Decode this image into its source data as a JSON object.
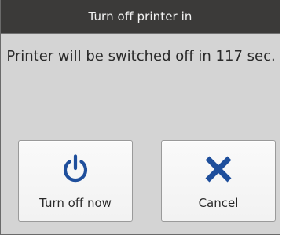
{
  "dialog": {
    "title": "Turn off printer in",
    "message": "Printer will be switched off in 117 sec."
  },
  "buttons": {
    "turn_off": {
      "label": "Turn off now",
      "icon": "power-icon"
    },
    "cancel": {
      "label": "Cancel",
      "icon": "close-icon"
    }
  },
  "colors": {
    "titlebar": "#3b3a39",
    "background": "#d4d4d4",
    "icon_blue": "#1f4f9c"
  }
}
